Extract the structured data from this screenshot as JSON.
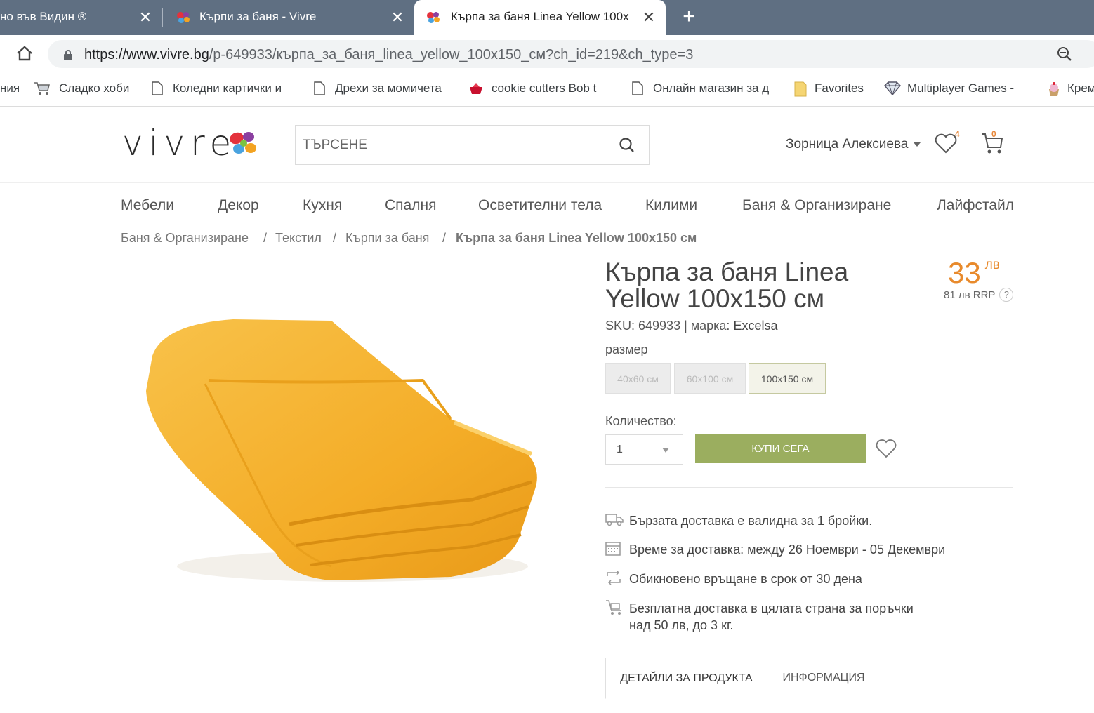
{
  "browser": {
    "tabs": [
      {
        "title": "но във Видин ®",
        "active": false
      },
      {
        "title": "Кърпи за баня - Vivre",
        "active": false
      },
      {
        "title": "Кърпа за баня Linea Yellow 100x",
        "active": true
      }
    ],
    "new_tab": "+",
    "close_glyph": "✕",
    "url_domain": "https://www.vivre.bg",
    "url_path": "/p-649933/кърпа_за_баня_linea_yellow_100x150_см?ch_id=219&ch_type=3",
    "bookmarks": [
      "ния",
      "Сладко хоби",
      "Коледни картички и",
      "Дрехи за момичета",
      "cookie cutters  Bob t",
      "Онлайн магазин за д",
      "Favorites",
      "Multiplayer Games -",
      "Крем"
    ]
  },
  "site": {
    "logo": "vivre",
    "search_placeholder": "ТЪРСЕНЕ",
    "user_name": "Зорница Алексиева",
    "wishlist_count": "4",
    "cart_count": "0",
    "nav": [
      "Мебели",
      "Декор",
      "Кухня",
      "Спалня",
      "Осветителни тела",
      "Килими",
      "Баня & Организиране",
      "Лайфстайл"
    ],
    "breadcrumb": [
      "Баня & Организиране",
      "Текстил",
      "Кърпи за баня",
      "Кърпа за баня Linea Yellow 100x150 см"
    ],
    "breadcrumb_sep": "/"
  },
  "product": {
    "title": "Кърпа за баня Linea Yellow 100x150 см",
    "price": "33",
    "price_currency": "лв",
    "rrp": "81 лв RRP",
    "rrp_help": "?",
    "sku_label": "SKU: 649933 | марка:",
    "brand": "Excelsa",
    "size_label": "размер",
    "sizes": [
      {
        "label": "40x60 см",
        "selected": false
      },
      {
        "label": "60x100 см",
        "selected": false
      },
      {
        "label": "100x150 см",
        "selected": true
      }
    ],
    "qty_label": "Количество:",
    "qty_value": "1",
    "buy_label": "КУПИ СЕГА",
    "info": [
      {
        "icon": "truck-icon",
        "text": "Бързата доставка е валидна за 1 бройки."
      },
      {
        "icon": "calendar-icon",
        "text": "Време за доставка: между 26 Ноември - 05 Декември"
      },
      {
        "icon": "return-icon",
        "text": "Обикновено връщане в срок от 30 дена"
      },
      {
        "icon": "cart-delivery-icon",
        "text": "Безплатна доставка в цялата страна за поръчки",
        "text2": "над 50 лв, до 3 кг."
      }
    ],
    "tabs": [
      "ДЕТАЙЛИ ЗА ПРОДУКТА",
      "ИНФОРМАЦИЯ"
    ]
  },
  "colors": {
    "tabbar": "#5f6f82",
    "accent_orange": "#e88a2c",
    "buy_green": "#9bae5f",
    "towel": "#f5b22e"
  }
}
